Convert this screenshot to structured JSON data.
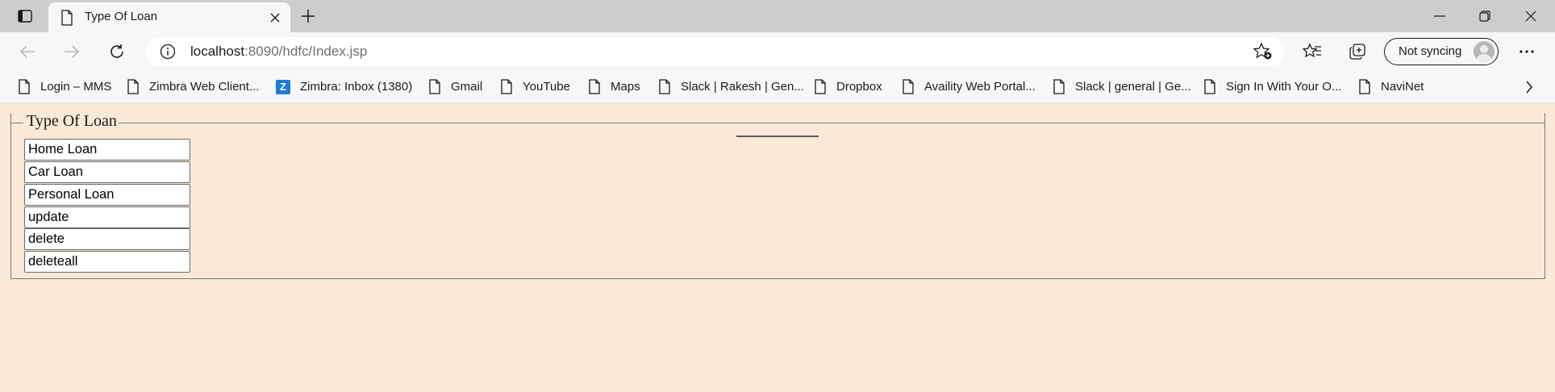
{
  "browser": {
    "tab": {
      "title": "Type Of Loan"
    },
    "address": {
      "host": "localhost",
      "rest": ":8090/hdfc/Index.jsp"
    },
    "profile": {
      "label": "Not syncing"
    },
    "bookmarks": [
      {
        "label": "Login – MMS",
        "icon": "page-icon"
      },
      {
        "label": "Zimbra Web Client...",
        "icon": "page-icon"
      },
      {
        "label": "Zimbra: Inbox (1380)",
        "icon": "zimbra-icon"
      },
      {
        "label": "Gmail",
        "icon": "page-icon"
      },
      {
        "label": "YouTube",
        "icon": "page-icon"
      },
      {
        "label": "Maps",
        "icon": "page-icon"
      },
      {
        "label": "Slack | Rakesh | Gen...",
        "icon": "page-icon"
      },
      {
        "label": "Dropbox",
        "icon": "page-icon"
      },
      {
        "label": "Availity Web Portal...",
        "icon": "page-icon"
      },
      {
        "label": "Slack | general | Ge...",
        "icon": "page-icon"
      },
      {
        "label": "Sign In With Your O...",
        "icon": "page-icon"
      },
      {
        "label": "NaviNet",
        "icon": "page-icon"
      }
    ],
    "zimbra_glyph": "Z"
  },
  "page": {
    "legend": "Type Of Loan",
    "inputs": [
      {
        "value": "Home Loan"
      },
      {
        "value": "Car Loan"
      },
      {
        "value": "Personal Loan"
      },
      {
        "value": "update"
      },
      {
        "value": "delete"
      },
      {
        "value": "deleteall"
      }
    ]
  },
  "colors": {
    "page_background": "#f9e9d6",
    "tabstrip": "#cdcdcd",
    "toolbar": "#f7f7f7",
    "zimbra_brand": "#1d7ad9"
  }
}
